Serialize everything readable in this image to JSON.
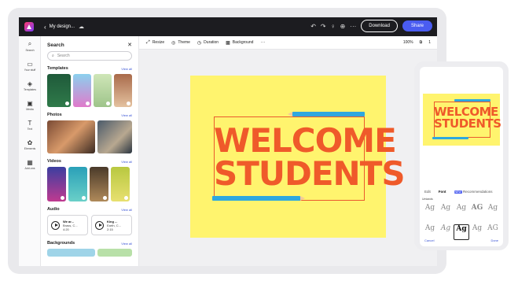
{
  "topbar": {
    "title": "My design...",
    "download_label": "Download",
    "share_label": "Share"
  },
  "rail": {
    "items": [
      {
        "label": "Search",
        "icon": "search-icon"
      },
      {
        "label": "Your stuff",
        "icon": "folder-icon"
      },
      {
        "label": "Templates",
        "icon": "templates-icon"
      },
      {
        "label": "Media",
        "icon": "media-icon"
      },
      {
        "label": "Text",
        "icon": "text-icon"
      },
      {
        "label": "Elements",
        "icon": "elements-icon"
      },
      {
        "label": "Add-ons",
        "icon": "addons-icon"
      }
    ]
  },
  "panel": {
    "title": "Search",
    "search_placeholder": "Search",
    "view_all": "View all",
    "sections": {
      "templates": "Templates",
      "photos": "Photos",
      "videos": "Videos",
      "audio": "Audio",
      "backgrounds": "Backgrounds"
    },
    "video_badges": [
      "29 s",
      "15 s",
      "15 s",
      "15 s"
    ],
    "audio_cards": [
      {
        "title": "We ar...",
        "meta": "Brass, C...",
        "duration": "4:20"
      },
      {
        "title": "King ...",
        "meta": "Earth, C...",
        "duration": "2:15"
      }
    ]
  },
  "toolbar": {
    "resize": "Resize",
    "theme": "Theme",
    "duration": "Duration",
    "background": "Background",
    "zoom": "100%",
    "page": "1"
  },
  "design": {
    "line1": "WELCOME",
    "line2": "STUDENTS",
    "bg_color": "#fff46e",
    "text_color": "#ef5a2a",
    "pencil_color": "#2ea8df"
  },
  "phone": {
    "tabs": [
      "Edit",
      "Font",
      "Recommendations"
    ],
    "new_badge": "NEW",
    "group_label": "Umlands",
    "fonts": [
      "Ag",
      "Ag",
      "Ag",
      "AG",
      "Ag",
      "Ag",
      "Ag",
      "Ag",
      "Ag",
      "AG"
    ],
    "cancel": "Cancel",
    "done": "Done"
  },
  "colors": {
    "accent": "#4a5cf0",
    "topbar": "#1c1c20"
  }
}
